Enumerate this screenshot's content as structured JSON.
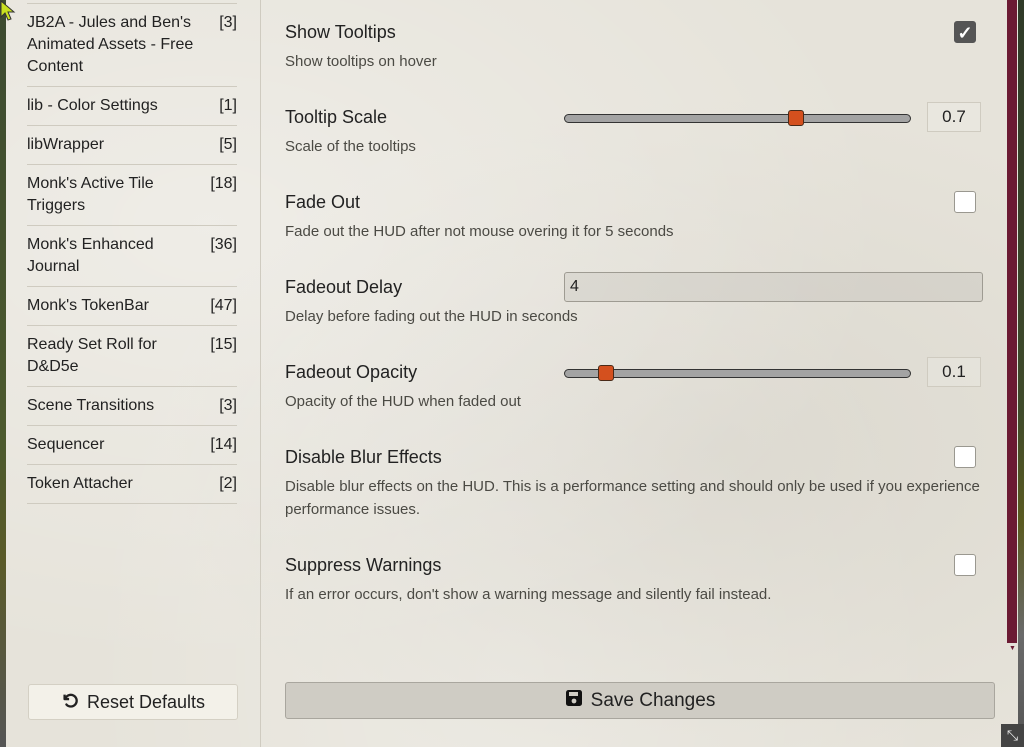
{
  "sidebar": {
    "categories": [
      {
        "name": "JB2A - Jules and Ben's Animated Assets - Free Content",
        "count": "[3]"
      },
      {
        "name": "lib - Color Settings",
        "count": "[1]"
      },
      {
        "name": "libWrapper",
        "count": "[5]"
      },
      {
        "name": "Monk's Active Tile Triggers",
        "count": "[18]"
      },
      {
        "name": "Monk's Enhanced Journal",
        "count": "[36]"
      },
      {
        "name": "Monk's TokenBar",
        "count": "[47]"
      },
      {
        "name": "Ready Set Roll for D&D5e",
        "count": "[15]"
      },
      {
        "name": "Scene Transitions",
        "count": "[3]"
      },
      {
        "name": "Sequencer",
        "count": "[14]"
      },
      {
        "name": "Token Attacher",
        "count": "[2]"
      }
    ],
    "reset_label": "Reset Defaults",
    "reset_icon": "undo-icon"
  },
  "settings": {
    "show_tooltips": {
      "label": "Show Tooltips",
      "hint": "Show tooltips on hover",
      "checked": true
    },
    "tooltip_scale": {
      "label": "Tooltip Scale",
      "hint": "Scale of the tooltips",
      "value": "0.7",
      "fraction": 0.67
    },
    "fade_out": {
      "label": "Fade Out",
      "hint": "Fade out the HUD after not mouse overing it for 5 seconds",
      "checked": false
    },
    "fadeout_delay": {
      "label": "Fadeout Delay",
      "hint": "Delay before fading out the HUD in seconds",
      "value": "4"
    },
    "fadeout_opacity": {
      "label": "Fadeout Opacity",
      "hint": "Opacity of the HUD when faded out",
      "value": "0.1",
      "fraction": 0.12
    },
    "disable_blur": {
      "label": "Disable Blur Effects",
      "hint": "Disable blur effects on the HUD. This is a performance setting and should only be used if you experience performance issues.",
      "checked": false
    },
    "suppress_warnings": {
      "label": "Suppress Warnings",
      "hint": "If an error occurs, don't show a warning message and silently fail instead.",
      "checked": false
    }
  },
  "footer": {
    "save_label": "Save Changes",
    "save_icon": "floppy-disk-icon"
  },
  "colors": {
    "accent": "#d4501e",
    "scrollbar": "#6b1a33",
    "panel": "#e6e3da"
  }
}
